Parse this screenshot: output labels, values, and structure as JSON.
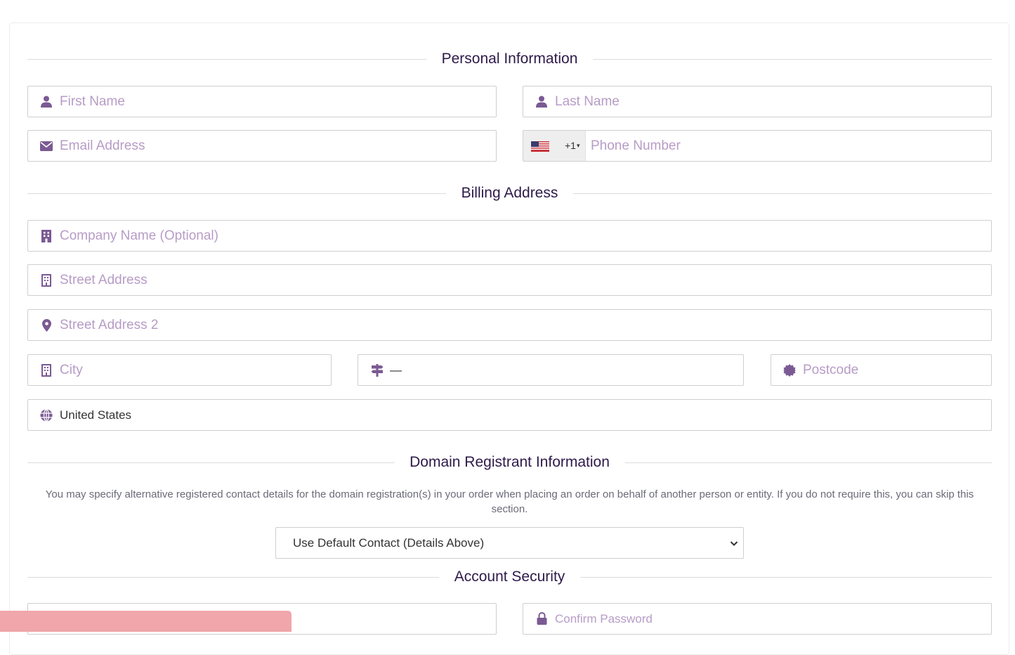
{
  "sections": {
    "personal": "Personal Information",
    "billing": "Billing Address",
    "domain": "Domain Registrant Information",
    "security": "Account Security"
  },
  "personal": {
    "first_name_placeholder": "First Name",
    "last_name_placeholder": "Last Name",
    "email_placeholder": "Email Address",
    "phone_placeholder": "Phone Number",
    "phone_dial_code": "+1",
    "phone_caret": "▾"
  },
  "billing": {
    "company_placeholder": "Company Name (Optional)",
    "street_placeholder": "Street Address",
    "street2_placeholder": "Street Address 2",
    "city_placeholder": "City",
    "state_value": "—",
    "postcode_placeholder": "Postcode",
    "country_value": "United States"
  },
  "domain": {
    "notice": "You may specify alternative registered contact details for the domain registration(s) in your order when placing an order on behalf of another person or entity. If you do not require this, you can skip this section.",
    "contact_select_value": "Use Default Contact (Details Above)"
  },
  "security": {
    "confirm_password_placeholder": "Confirm Password"
  },
  "colors": {
    "icon": "#7b5a93",
    "placeholder": "#b79cc6",
    "heading": "#2e1a4a",
    "toast": "#f0a6aa"
  },
  "icons": {
    "name": "user-icon",
    "email": "envelope-icon",
    "company": "building-icon",
    "street": "building-outline-icon",
    "street2": "map-marker-icon",
    "city": "building-outline-icon",
    "state": "signpost-icon",
    "postcode": "certificate-icon",
    "country": "globe-icon",
    "password": "lock-icon"
  }
}
